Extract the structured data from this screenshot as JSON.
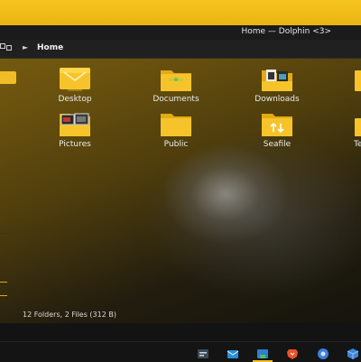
{
  "window": {
    "title": "Home — Dolphin <3>"
  },
  "breadcrumb": {
    "arrow": "►",
    "current": "Home"
  },
  "items": [
    {
      "label": "Desktop",
      "icon": "desktop-folder-icon"
    },
    {
      "label": "Documents",
      "icon": "documents-folder-icon"
    },
    {
      "label": "Downloads",
      "icon": "downloads-folder-icon"
    },
    {
      "label": "Pictures",
      "icon": "pictures-folder-icon"
    },
    {
      "label": "Public",
      "icon": "folder-icon"
    },
    {
      "label": "Seafile",
      "icon": "seafile-folder-icon"
    },
    {
      "label": "Te",
      "icon": "folder-icon"
    }
  ],
  "status": {
    "text": "12 Folders, 2 Files (312 B)"
  },
  "taskbar": {
    "icons": [
      "system-monitor-icon",
      "email-icon",
      "file-manager-icon",
      "brave-browser-icon",
      "chrome-browser-icon",
      "box-app-icon"
    ]
  },
  "colors": {
    "accent": "#f1bd24",
    "folder": "#f6c42a",
    "folder_dark": "#e2ab14"
  }
}
